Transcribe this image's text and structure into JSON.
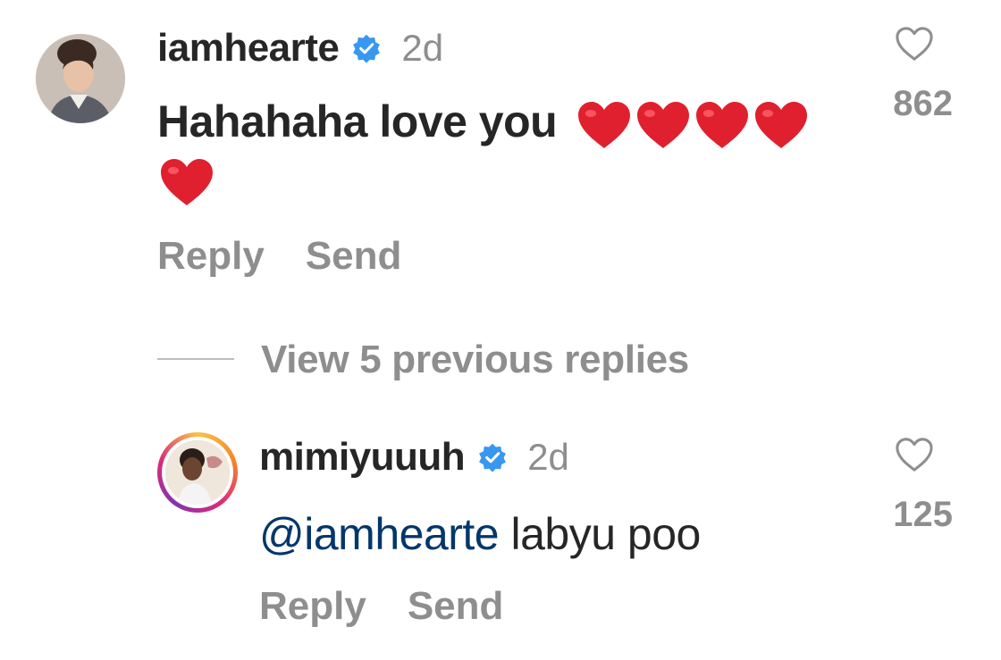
{
  "comment": {
    "username": "iamhearte",
    "time": "2d",
    "text": "Hahahaha love you",
    "heart_emojis_line1": 4,
    "heart_emojis_line2": 1,
    "like_count": "862",
    "reply_label": "Reply",
    "send_label": "Send"
  },
  "thread": {
    "view_replies_label": "View 5 previous replies"
  },
  "reply": {
    "username": "mimiyuuuh",
    "time": "2d",
    "mention": "@iamhearte",
    "text": " labyu poo",
    "like_count": "125",
    "reply_label": "Reply",
    "send_label": "Send"
  },
  "colors": {
    "verified_badge": "#3897f0",
    "mention": "#00376b",
    "secondary_text": "#8e8e8e",
    "heart_emoji": "#e0202e",
    "story_ring": "#d6249f"
  }
}
